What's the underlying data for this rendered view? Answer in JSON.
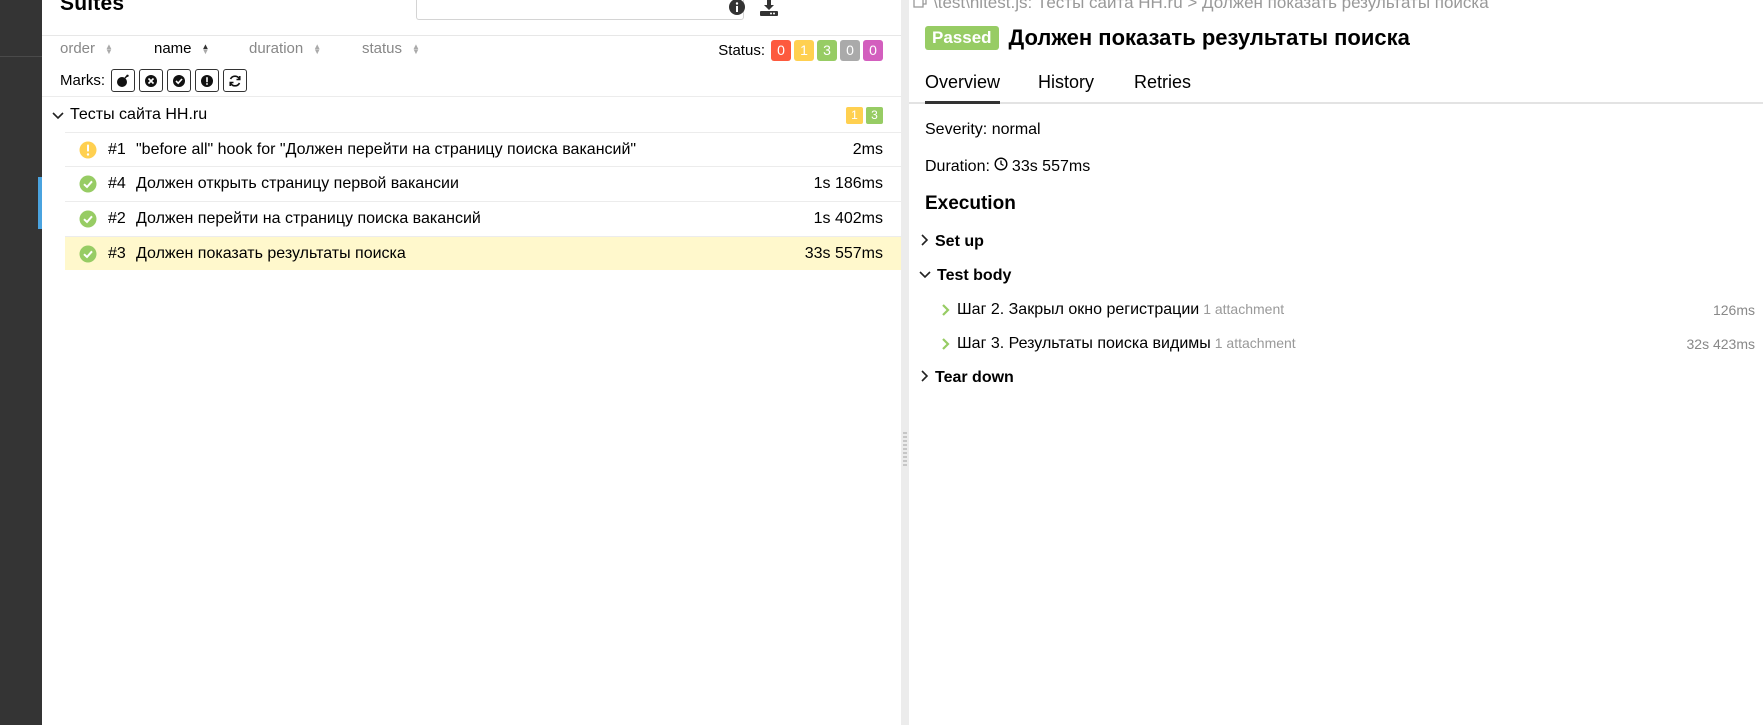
{
  "colors": {
    "failed": "#fd5a3e",
    "broken": "#ffd050",
    "passed": "#97cc64",
    "skipped": "#aaaaaa",
    "unknown": "#d35ebe",
    "selected_row": "#fff8cc"
  },
  "suites": {
    "title": "Suites",
    "search_placeholder": "",
    "info_icon": "info-circle-icon",
    "download_icon": "download-icon",
    "sort": {
      "order": "order",
      "name": "name",
      "duration": "duration",
      "status": "status",
      "active": "name"
    },
    "status_filter": {
      "label": "Status:",
      "failed": "0",
      "broken": "1",
      "passed": "3",
      "skipped": "0",
      "unknown": "0"
    },
    "marks": {
      "label": "Marks:",
      "icons": [
        "flaky-bomb-icon",
        "new-failed-icon",
        "new-passed-icon",
        "new-broken-icon",
        "retries-icon"
      ]
    },
    "group": {
      "name": "Тесты сайта HH.ru",
      "broken_count": "1",
      "passed_count": "3"
    },
    "tests": [
      {
        "status": "broken",
        "num": "#1",
        "title": "\"before all\" hook for \"Должен перейти на страницу поиска вакансий\"",
        "duration": "2ms"
      },
      {
        "status": "passed",
        "num": "#4",
        "title": "Должен открыть страницу первой вакансии",
        "duration": "1s 186ms"
      },
      {
        "status": "passed",
        "num": "#2",
        "title": "Должен перейти на страницу поиска вакансий",
        "duration": "1s 402ms"
      },
      {
        "status": "passed",
        "num": "#3",
        "title": "Должен показать результаты поиска",
        "duration": "33s 557ms",
        "selected": true
      }
    ]
  },
  "detail": {
    "breadcrumb": "\\test\\nitest.js: Тесты сайта HH.ru > Должен показать результаты поиска",
    "status_badge": "Passed",
    "title": "Должен показать результаты поиска",
    "tabs": {
      "overview": "Overview",
      "history": "History",
      "retries": "Retries"
    },
    "severity": "Severity: normal",
    "duration_label": "Duration:",
    "duration_value": "33s 557ms",
    "execution_title": "Execution",
    "setup": "Set up",
    "test_body": "Test body",
    "teardown": "Tear down",
    "steps": [
      {
        "name": "Шаг 2. Закрыл окно регистрации",
        "attachments": "1 attachment",
        "duration": "126ms"
      },
      {
        "name": "Шаг 3. Результаты поиска видимы",
        "attachments": "1 attachment",
        "duration": "32s 423ms"
      }
    ]
  }
}
